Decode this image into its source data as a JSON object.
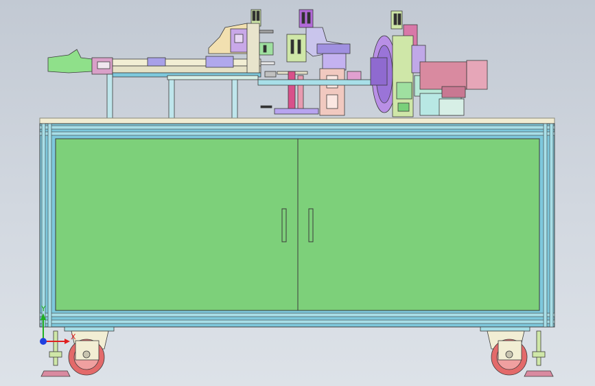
{
  "viewport": {
    "background": "#cfd5dd",
    "model": "workbench-cabinet-assembly"
  },
  "triad": {
    "x_label": "X",
    "y_label": "Y",
    "x_color": "#e02020",
    "y_color": "#20b020",
    "z_color": "#2040e0"
  },
  "colors": {
    "cabinet_fill": "#7dd07a",
    "frame_blue": "#7ec8dc",
    "frame_light": "#a8dfe8",
    "tabletop": "#f1ecd2",
    "wheel": "#e36a6a",
    "motor": "#d98aa0",
    "purple_part": "#a070e0",
    "outline": "#3a3a3a"
  },
  "parts": {
    "tabletop": "tabletop",
    "cabinet": "cabinet",
    "left_door": "left-door",
    "right_door": "right-door",
    "feeder_arm": "feeder-arm",
    "pressing_unit_left": "pressing-unit-left",
    "pressing_unit_middle": "pressing-unit-middle",
    "rotary_disc": "rotary-disc",
    "motor": "motor",
    "caster_left": "caster-left",
    "caster_right": "caster-right"
  }
}
